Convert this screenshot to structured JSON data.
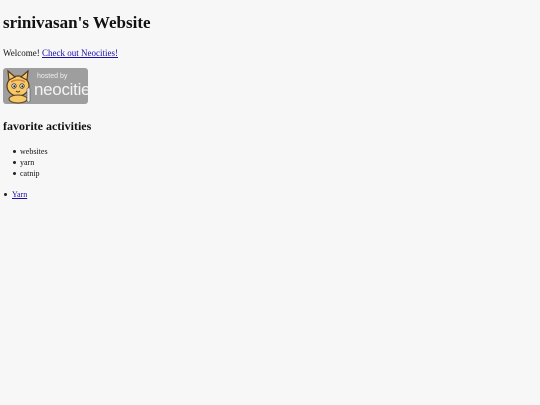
{
  "header": {
    "title": "srinivasan's Website"
  },
  "welcome": {
    "text": "Welcome!",
    "link_label": "Check out Neocities!"
  },
  "badge": {
    "small_text": "hosted by",
    "big_text": "neocities",
    "icon": "neocities-cat-icon"
  },
  "section": {
    "title": "favorite activities",
    "items": [
      "websites",
      "yarn",
      "catnip"
    ]
  },
  "links": {
    "items": [
      "Yarn"
    ]
  },
  "colors": {
    "background": "#f7f7f7",
    "link": "#1a0dab",
    "badge_bg": "#9e9e9e"
  }
}
